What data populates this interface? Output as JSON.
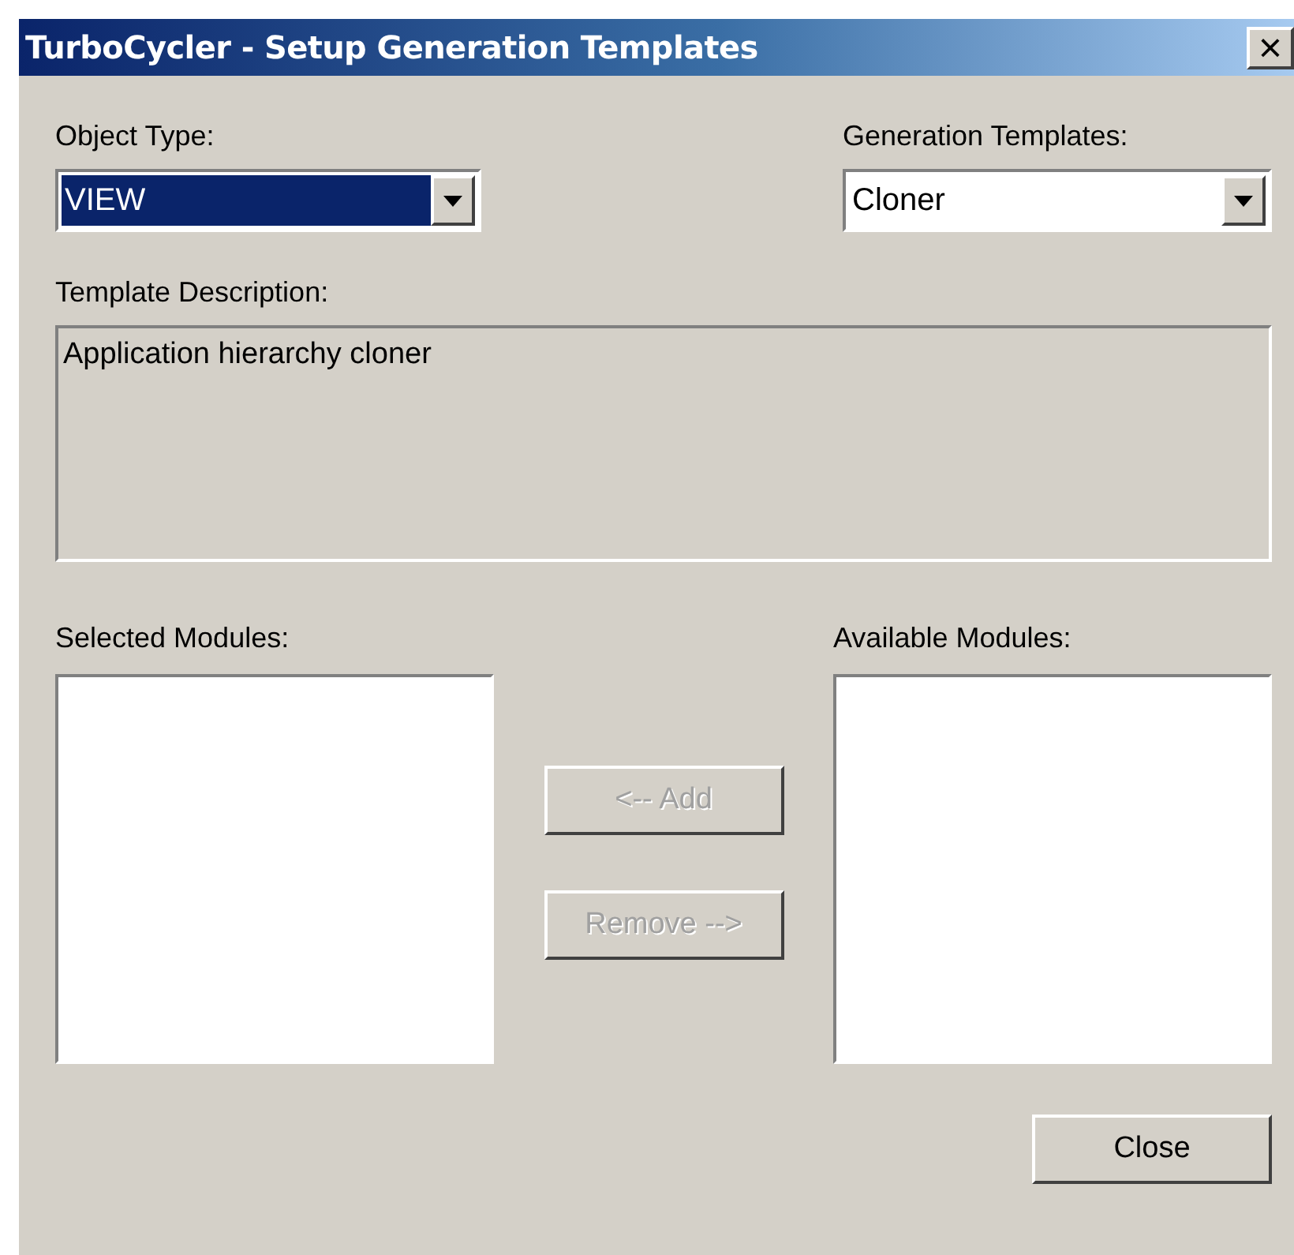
{
  "window": {
    "title": "TurboCycler - Setup Generation Templates",
    "close_glyph": "×"
  },
  "object_type": {
    "label": "Object Type:",
    "value": "VIEW",
    "focused": true
  },
  "generation_templates": {
    "label": "Generation Templates:",
    "value": "Cloner",
    "focused": false
  },
  "template_description": {
    "label": "Template Description:",
    "value": "Application hierarchy cloner"
  },
  "selected_modules": {
    "label": "Selected Modules:"
  },
  "available_modules": {
    "label": "Available Modules:"
  },
  "move_buttons": [
    {
      "label": "<-- Add",
      "disabled": true
    },
    {
      "label": "Remove -->",
      "disabled": true
    }
  ],
  "close_button": {
    "label": "Close",
    "disabled": false
  }
}
